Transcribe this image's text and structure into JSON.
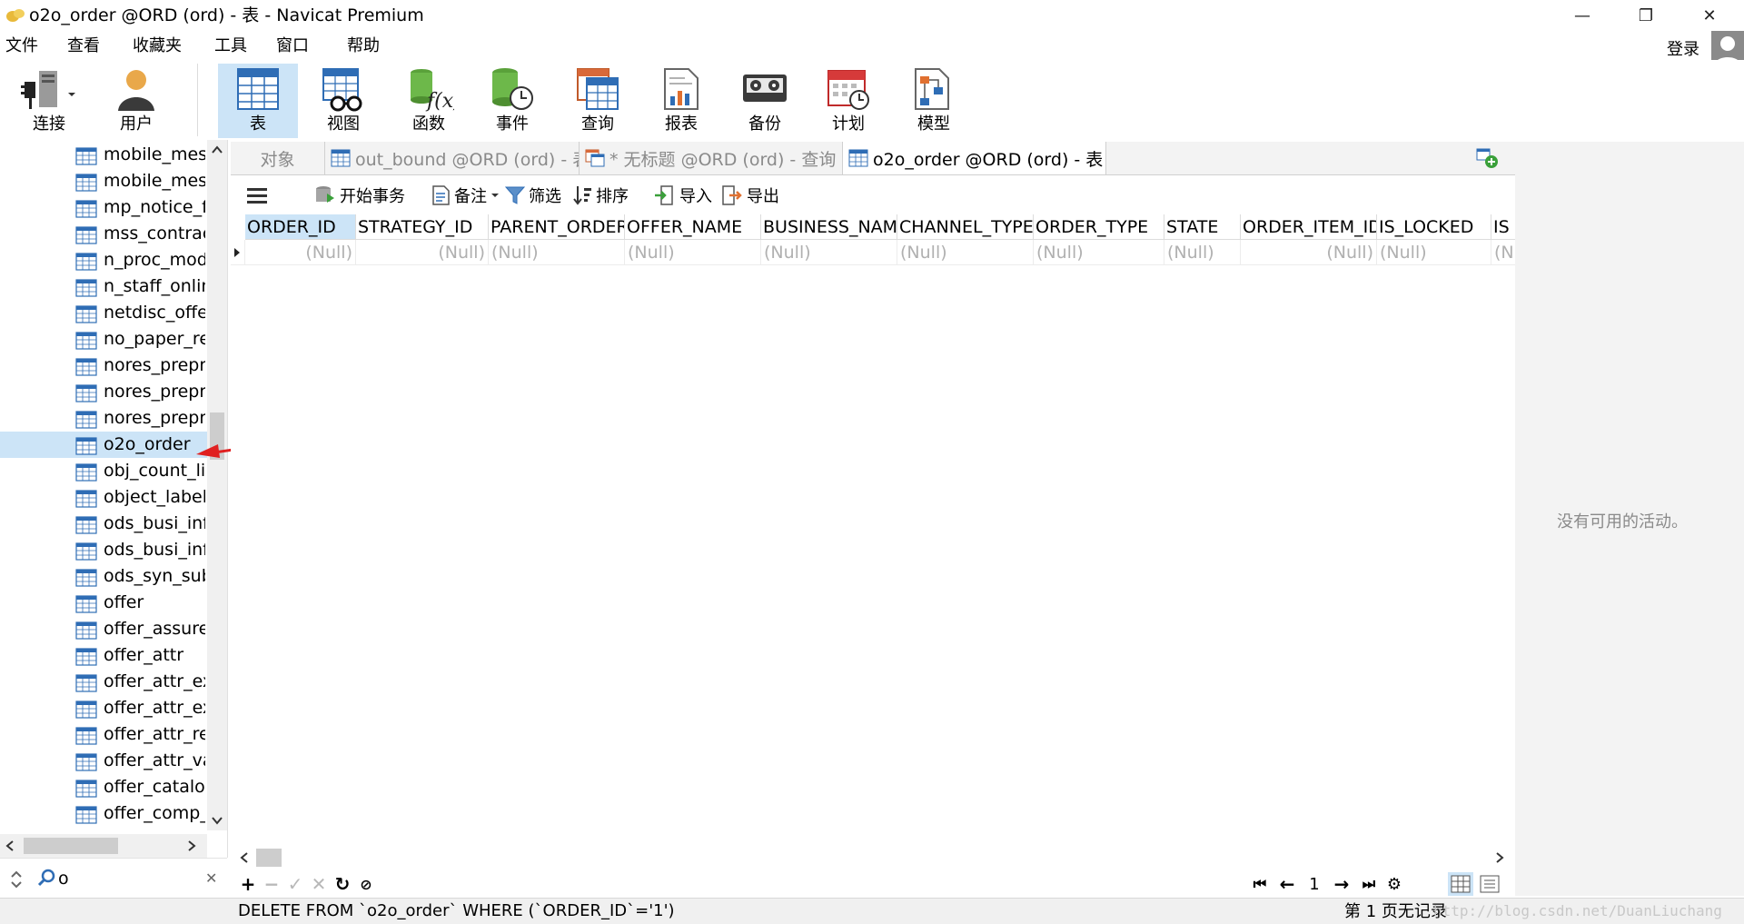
{
  "window": {
    "title": "o2o_order @ORD (ord) - 表 - Navicat Premium",
    "minimize": "—",
    "maximize": "❐",
    "close": "✕"
  },
  "menu": [
    "文件",
    "查看",
    "收藏夹",
    "工具",
    "窗口",
    "帮助"
  ],
  "account": {
    "login_label": "登录"
  },
  "toolbar": [
    {
      "id": "connect",
      "label": "连接"
    },
    {
      "id": "user",
      "label": "用户"
    },
    {
      "id": "table",
      "label": "表",
      "active": true
    },
    {
      "id": "view",
      "label": "视图"
    },
    {
      "id": "function",
      "label": "函数"
    },
    {
      "id": "event",
      "label": "事件"
    },
    {
      "id": "query",
      "label": "查询"
    },
    {
      "id": "report",
      "label": "报表"
    },
    {
      "id": "backup",
      "label": "备份"
    },
    {
      "id": "schedule",
      "label": "计划"
    },
    {
      "id": "model",
      "label": "模型"
    }
  ],
  "tree": {
    "items": [
      "mobile_mess",
      "mobile_mess",
      "mp_notice_fi",
      "mss_contract",
      "n_proc_mode",
      "n_staff_onlin",
      "netdisc_offer",
      "no_paper_rej",
      "nores_preprc",
      "nores_preprc",
      "nores_preprc",
      "o2o_order",
      "obj_count_lir",
      "object_label_",
      "ods_busi_infc",
      "ods_busi_infc",
      "ods_syn_subs",
      "offer",
      "offer_assure_",
      "offer_attr",
      "offer_attr_ext",
      "offer_attr_ext",
      "offer_attr_rer",
      "offer_attr_val",
      "offer_catalog",
      "offer_comp_c"
    ],
    "selected": "o2o_order",
    "search_value": "o",
    "clear_glyph": "✕"
  },
  "tabs": [
    {
      "label": "对象",
      "icon": "none"
    },
    {
      "label": "out_bound @ORD (ord) - 表",
      "icon": "table"
    },
    {
      "label": "* 无标题 @ORD (ord) - 查询",
      "icon": "query"
    },
    {
      "label": "o2o_order @ORD (ord) - 表",
      "icon": "table",
      "active": true
    }
  ],
  "object_toolbar": {
    "begin_transaction": "开始事务",
    "memo": "备注",
    "filter": "筛选",
    "sort": "排序",
    "import": "导入",
    "export": "导出"
  },
  "grid": {
    "columns": [
      "ORDER_ID",
      "STRATEGY_ID",
      "PARENT_ORDER_",
      "OFFER_NAME",
      "BUSINESS_NAME",
      "CHANNEL_TYPE",
      "ORDER_TYPE",
      "STATE",
      "ORDER_ITEM_ID",
      "IS_LOCKED",
      "IS"
    ],
    "row": [
      "(Null)",
      "(Null)",
      "(Null)",
      "(Null)",
      "(Null)",
      "(Null)",
      "(Null)",
      "(Null)",
      "(Null)",
      "(Null)",
      "(N"
    ]
  },
  "nav": {
    "page": "1"
  },
  "status": {
    "sql": "DELETE FROM `o2o_order` WHERE (`ORDER_ID`='1')",
    "page_info": "第 1 页无记录",
    "watermark": "http://blog.csdn.net/DuanLiuchang"
  },
  "info_panel": {
    "empty_text": "没有可用的活动。"
  },
  "colors": {
    "selection": "#cce4f7",
    "null_text": "#b0b0b0",
    "panel_bg": "#f3f3f3",
    "arrow": "#e02020"
  }
}
